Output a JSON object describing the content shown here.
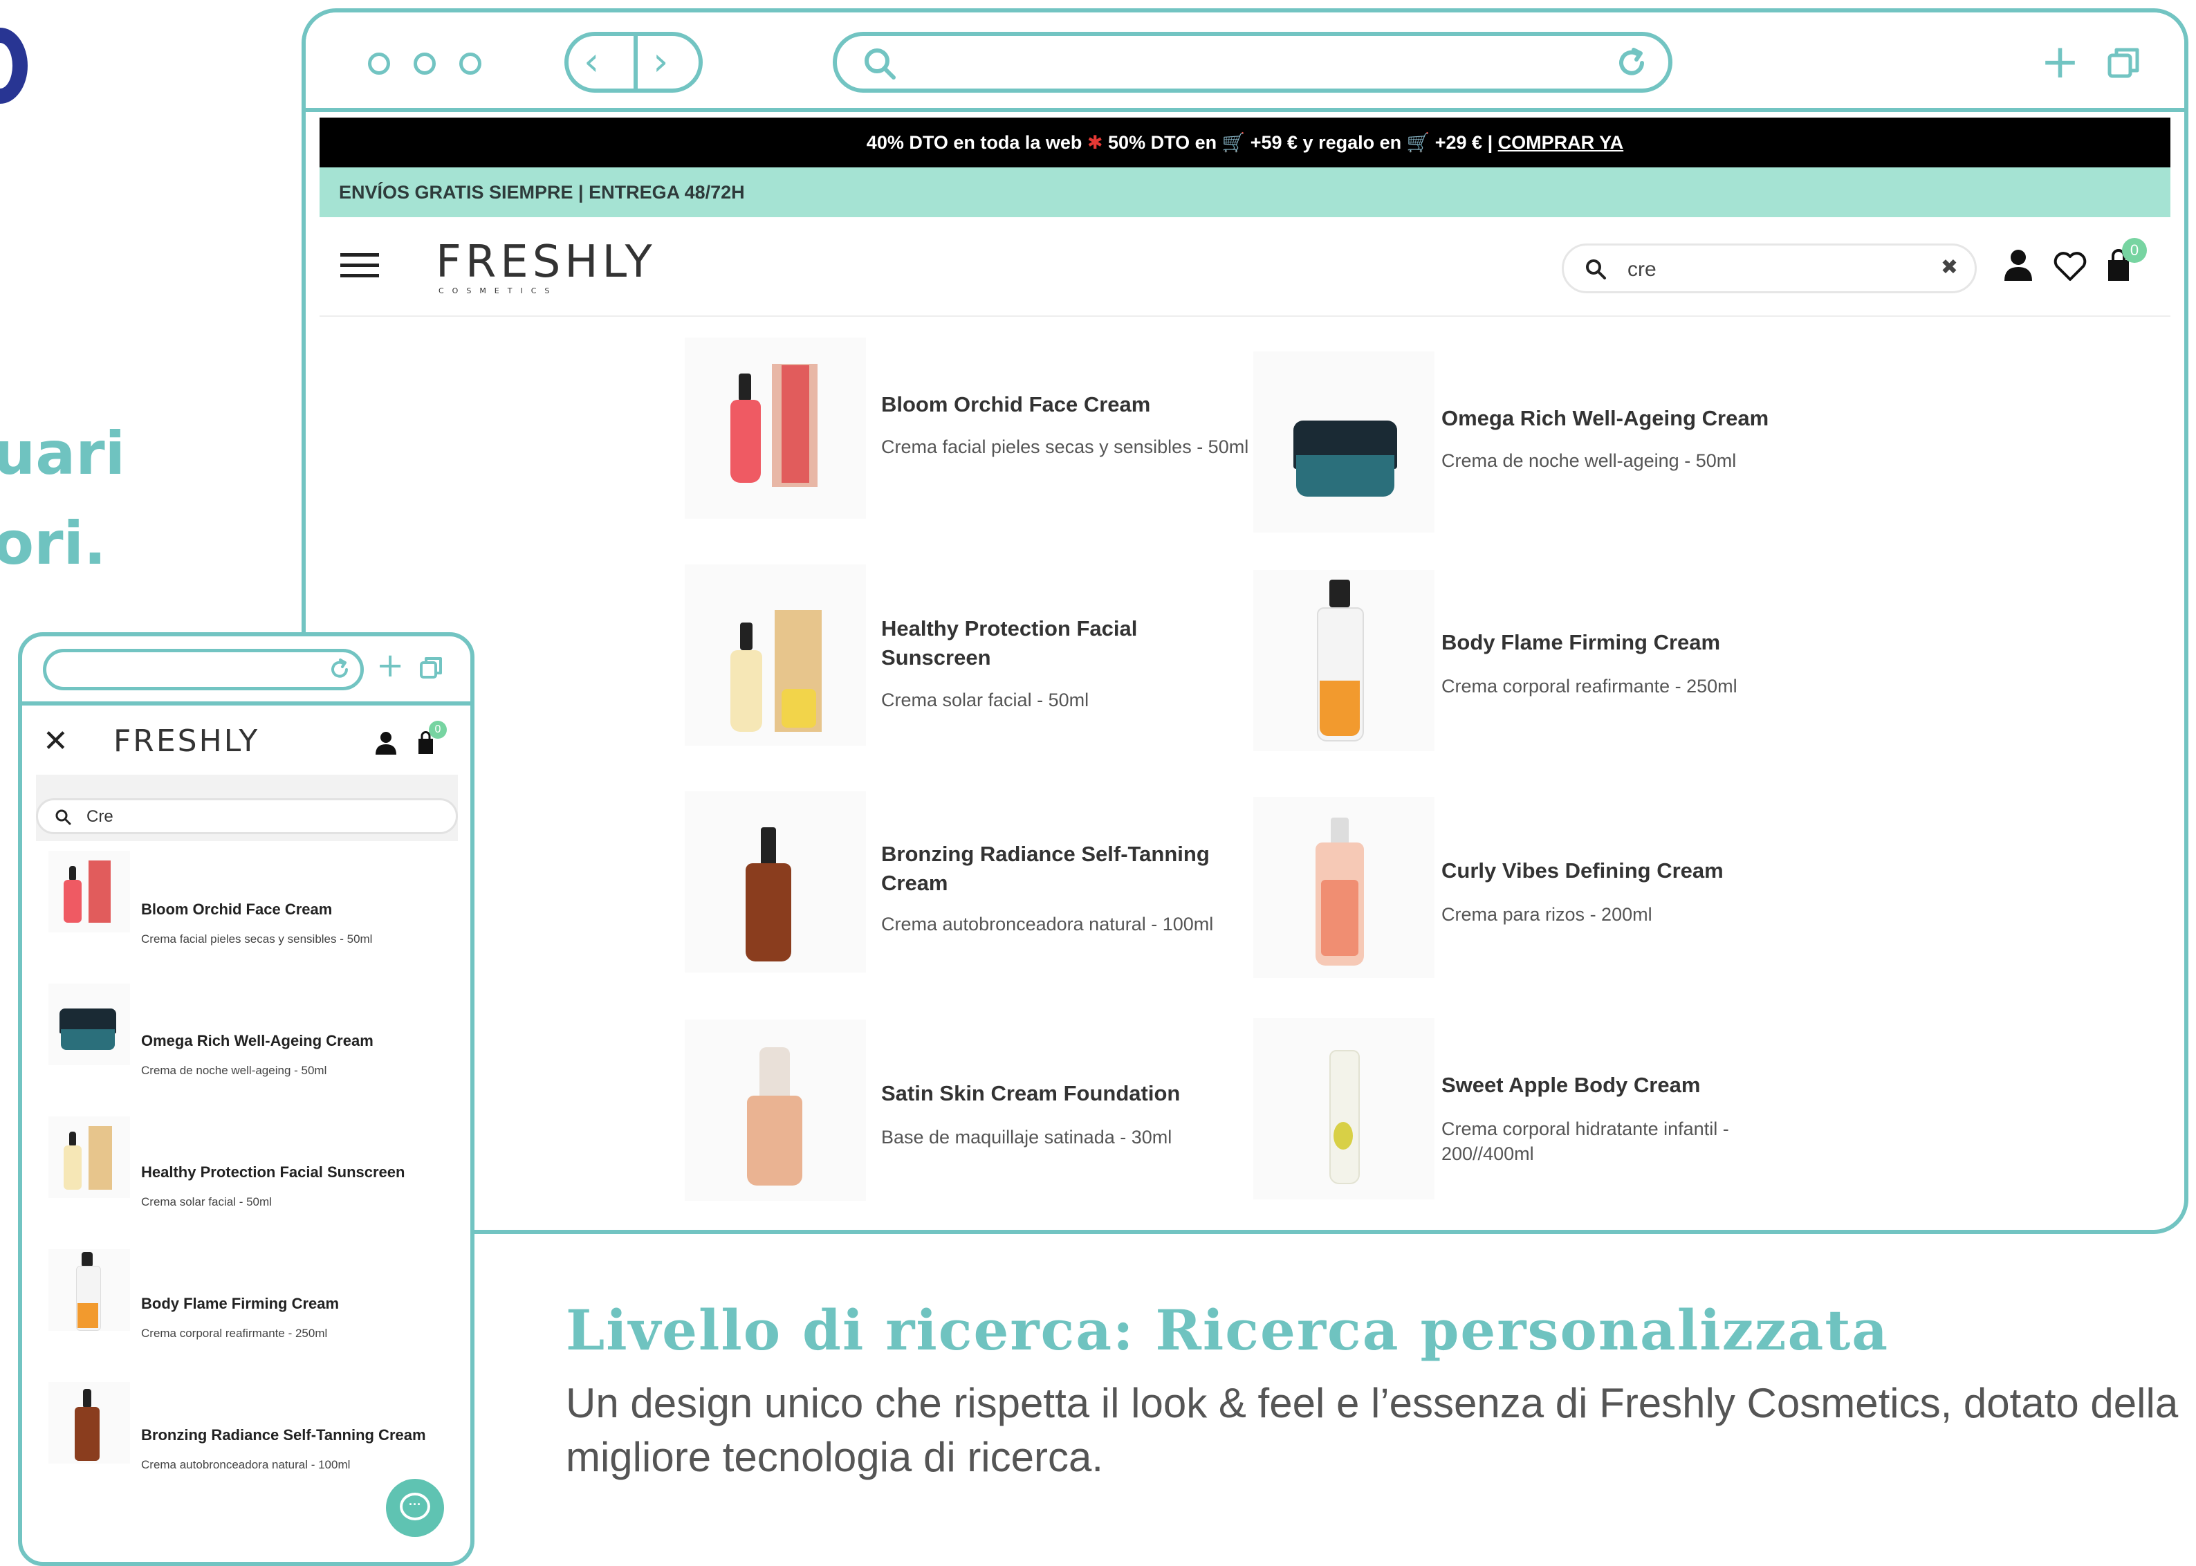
{
  "slide": {
    "left_fragment_1": "uari",
    "left_fragment_2": "ori.",
    "caption_title": "Livello di ricerca: Ricerca personalizzata",
    "caption_body": "Un design unico che rispetta il look & feel e l’essenza di Freshly Cosmetics, dotato della migliore tecnologia di ricerca."
  },
  "colors": {
    "accent": "#72c4c2",
    "mint_bar": "#a5e3d3",
    "chat": "#5fc3b2",
    "badge": "#77d4a1"
  },
  "browser": {
    "promo": {
      "part1": "40% DTO en toda la web",
      "part2": "50% DTO en",
      "part3": "+59 € y regalo en",
      "part4": "+29 € |",
      "cta": "COMPRAR YA"
    },
    "shipping": "ENVÍOS GRATIS SIEMPRE | ENTREGA 48/72H",
    "logo": "FRESHLY",
    "logo_sub": "COSMETICS",
    "search_query": "cre",
    "cart_count": "0",
    "icons": [
      "hamburger-icon",
      "search-icon",
      "clear-icon",
      "user-icon",
      "heart-icon",
      "cart-icon",
      "chat-icon"
    ]
  },
  "products": [
    {
      "name": "Bloom Orchid Face Cream",
      "desc": "Crema facial pieles secas y sensibles - 50ml"
    },
    {
      "name": "Omega Rich Well-Ageing Cream",
      "desc": "Crema de noche well-ageing - 50ml"
    },
    {
      "name": "Healthy Protection Facial Sunscreen",
      "desc": "Crema solar facial - 50ml"
    },
    {
      "name": "Body Flame Firming Cream",
      "desc": "Crema corporal reafirmante - 250ml"
    },
    {
      "name": "Bronzing Radiance Self-Tanning Cream",
      "desc": "Crema autobronceadora natural - 100ml"
    },
    {
      "name": "Curly Vibes Defining Cream",
      "desc": "Crema para rizos - 200ml"
    },
    {
      "name": "Satin Skin Cream Foundation",
      "desc": "Base de maquillaje satinada - 30ml"
    },
    {
      "name": "Sweet Apple Body Cream",
      "desc": "Crema corporal hidratante infantil - 200//400ml"
    }
  ],
  "mobile": {
    "logo": "FRESHLY",
    "search_query": "Cre",
    "cart_count": "0",
    "products": [
      {
        "name": "Bloom Orchid Face Cream",
        "desc": "Crema facial pieles secas y sensibles - 50ml"
      },
      {
        "name": "Omega Rich Well-Ageing Cream",
        "desc": "Crema de noche well-ageing - 50ml"
      },
      {
        "name": "Healthy Protection Facial Sunscreen",
        "desc": "Crema solar facial - 50ml"
      },
      {
        "name": "Body Flame Firming Cream",
        "desc": "Crema corporal reafirmante - 250ml"
      },
      {
        "name": "Bronzing Radiance Self-Tanning Cream",
        "desc": "Crema autobronceadora natural - 100ml"
      }
    ]
  }
}
